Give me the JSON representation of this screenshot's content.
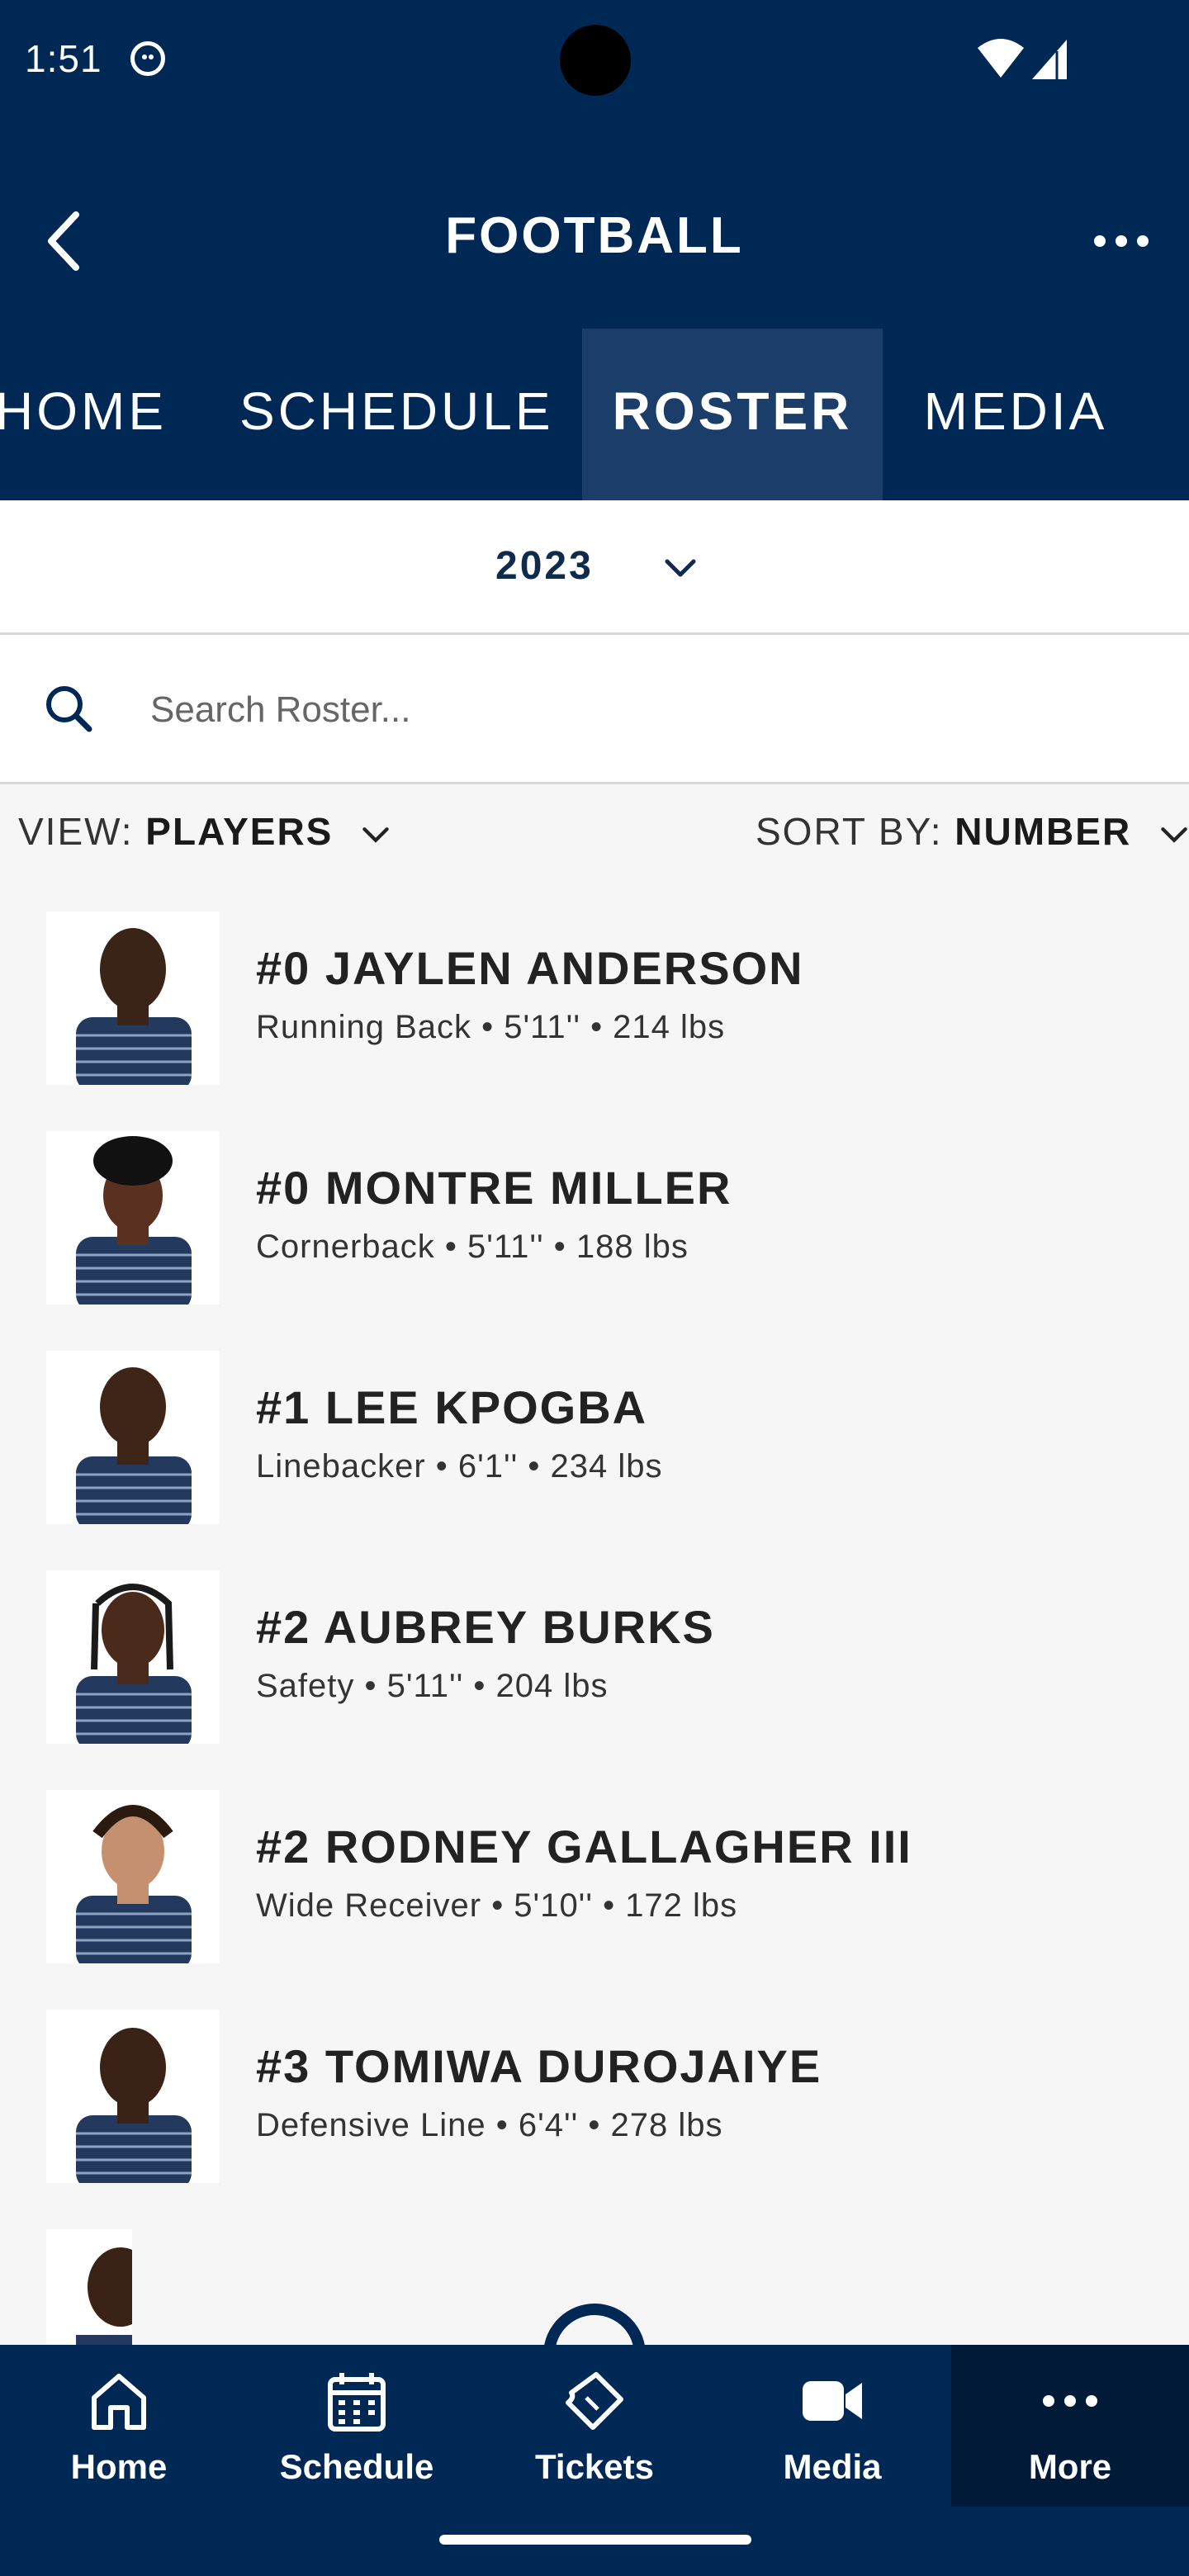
{
  "status_bar": {
    "time": "1:51"
  },
  "header": {
    "title": "FOOTBALL"
  },
  "tabs": [
    {
      "label": "HOME",
      "active": false
    },
    {
      "label": "SCHEDULE",
      "active": false
    },
    {
      "label": "ROSTER",
      "active": true
    },
    {
      "label": "MEDIA",
      "active": false
    }
  ],
  "season": {
    "year": "2023"
  },
  "search": {
    "placeholder": "Search Roster..."
  },
  "filters": {
    "view_prefix": "VIEW: ",
    "view_value": "PLAYERS",
    "sort_prefix": "SORT BY: ",
    "sort_value": "NUMBER"
  },
  "players": [
    {
      "name": "#0 JAYLEN ANDERSON",
      "details": "Running Back • 5'11'' • 214 lbs"
    },
    {
      "name": "#0 MONTRE MILLER",
      "details": "Cornerback • 5'11'' • 188 lbs"
    },
    {
      "name": "#1 LEE KPOGBA",
      "details": "Linebacker • 6'1'' • 234 lbs"
    },
    {
      "name": "#2 AUBREY BURKS",
      "details": "Safety • 5'11'' • 204 lbs"
    },
    {
      "name": "#2 RODNEY GALLAGHER III",
      "details": "Wide Receiver • 5'10'' • 172 lbs"
    },
    {
      "name": "#3 TOMIWA DUROJAIYE",
      "details": "Defensive Line • 6'4'' • 278 lbs"
    }
  ],
  "bottom_nav": [
    {
      "label": "Home",
      "icon": "home-icon"
    },
    {
      "label": "Schedule",
      "icon": "calendar-icon"
    },
    {
      "label": "Tickets",
      "icon": "ticket-icon"
    },
    {
      "label": "Media",
      "icon": "video-icon"
    },
    {
      "label": "More",
      "icon": "more-icon",
      "active": true
    }
  ],
  "colors": {
    "primary": "#002855",
    "active_tab": "#1b3d6a",
    "jersey_gold": "#eaaa00"
  }
}
